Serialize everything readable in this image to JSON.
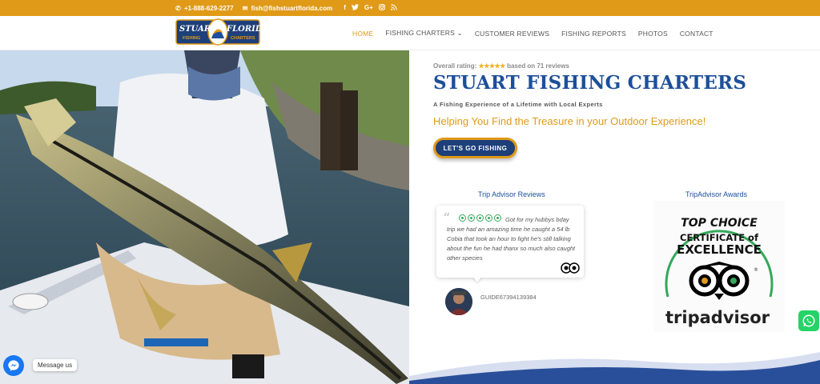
{
  "topbar": {
    "phone": "+1-888-629-2277",
    "email": "fish@fishstuartflorida.com",
    "social_icons": [
      "facebook-icon",
      "twitter-icon",
      "google-plus-icon",
      "instagram-icon",
      "rss-icon"
    ],
    "background": "#e09a17"
  },
  "logo": {
    "line1_left": "STUART",
    "line1_right": "FLORIDA",
    "line2_left": "FISHING",
    "line2_right": "CHARTERS"
  },
  "nav": {
    "items": [
      {
        "label": "HOME",
        "active": true
      },
      {
        "label": "FISHING CHARTERS ⌄",
        "active": false
      },
      {
        "label": "CUSTOMER REVIEWS",
        "active": false
      },
      {
        "label": "FISHING REPORTS",
        "active": false
      },
      {
        "label": "PHOTOS",
        "active": false
      },
      {
        "label": "CONTACT",
        "active": false
      }
    ]
  },
  "hero": {
    "rating_prefix": "Overall rating:",
    "stars": "★★★★★",
    "rating_suffix": "based on 71 reviews",
    "title": "STUART FISHING CHARTERS",
    "subtitle": "A Fishing Experience of a Lifetime with Local Experts",
    "tagline": "Helping You Find the Treasure in your Outdoor Experience!",
    "cta_label": "LET'S GO FISHING"
  },
  "reviews": {
    "heading": "Trip Advisor Reviews",
    "bubble_rating": 5,
    "text": "Got for my hubbys bday trip we had an amazing time he caught a 54 lb Cobia that took an hour to fight he's still talking about the fun he had thanx so much also caught other species",
    "reviewer": "GUIDE67394139384"
  },
  "awards": {
    "heading": "TripAdvisor Awards",
    "top_choice": "TOP CHOICE",
    "certificate_of": "CERTIFICATE of",
    "excellence": "EXCELLENCE",
    "brand": "tripadvisor",
    "registered": "®"
  },
  "widgets": {
    "messenger_label": "Message us"
  },
  "colors": {
    "accent": "#e09a17",
    "brand_blue": "#1d4f9a",
    "tripadvisor_green": "#34a85a"
  }
}
